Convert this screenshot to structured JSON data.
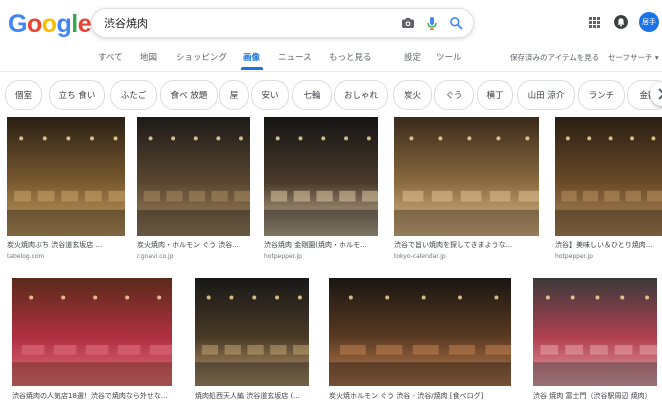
{
  "logo": {
    "text": "Google",
    "letters": [
      "G",
      "o",
      "o",
      "g",
      "l",
      "e"
    ],
    "colors": [
      "#4285f4",
      "#ea4335",
      "#fbbc05",
      "#4285f4",
      "#34a853",
      "#ea4335"
    ]
  },
  "search": {
    "value": "渋谷焼肉",
    "icons": [
      "camera-icon",
      "mic-icon",
      "search-icon"
    ]
  },
  "account": {
    "avatar_text": "居手"
  },
  "tabs": [
    {
      "label": "すべて",
      "active": false
    },
    {
      "label": "地図",
      "active": false
    },
    {
      "label": "ショッピング",
      "active": false
    },
    {
      "label": "画像",
      "active": true
    },
    {
      "label": "ニュース",
      "active": false
    },
    {
      "label": "もっと見る",
      "active": false
    },
    {
      "label": "設定",
      "active": false
    },
    {
      "label": "ツール",
      "active": false
    }
  ],
  "tools_right": {
    "saved": "保存済みのアイテムを見る",
    "safesearch": "セーフサーチ ▾"
  },
  "chips": [
    "個室",
    "立ち 食い",
    "ふたご",
    "食べ 放題",
    "屋",
    "安い",
    "七輪",
    "おしゃれ",
    "炭火",
    "ぐう",
    "横丁",
    "山田 涼介",
    "ランチ",
    "金額"
  ],
  "accent": "#1a73e8",
  "results": [
    {
      "caption": "炭火焼肉ぶち 渋谷道玄坂店 ...",
      "source": "tabelog.com",
      "palette": [
        "#2a2014",
        "#7a5a30",
        "#c8a266"
      ]
    },
    {
      "caption": "炭火焼肉・ホルモン ぐう 渋谷...",
      "source": "r.gnavi.co.jp",
      "palette": [
        "#1c1a18",
        "#5a4630",
        "#a88a60"
      ]
    },
    {
      "caption": "渋谷焼肉 金剛園(焼肉・ホルモ...",
      "source": "hotpepper.jp",
      "palette": [
        "#141414",
        "#4a3a2a",
        "#d8c4a4"
      ]
    },
    {
      "caption": "渋谷で旨い焼肉を探してきまような...",
      "source": "tokyo-calendar.jp",
      "palette": [
        "#3a2a1a",
        "#8a6a40",
        "#e0c090"
      ]
    },
    {
      "caption": "渋谷】美味しい＆ひとり焼肉...",
      "source": "hotpepper.jp",
      "palette": [
        "#2a1e12",
        "#6a4a28",
        "#b89060"
      ]
    },
    {
      "caption": "渋谷焼肉の人気店18選！渋谷で焼肉なら外せな...",
      "source": "",
      "palette": [
        "#5a2a1a",
        "#b03040",
        "#e07080"
      ]
    },
    {
      "caption": "焼肉処西天人編 渋谷道玄坂店 (...",
      "source": "",
      "palette": [
        "#181818",
        "#4a3a26",
        "#c0a070"
      ]
    },
    {
      "caption": "炭火焼ホルモン ぐう 渋谷 - 渋谷/焼肉 [食べログ]",
      "source": "",
      "palette": [
        "#1a1612",
        "#5a3a22",
        "#c08050"
      ]
    },
    {
      "caption": "渋谷 焼肉 富士門（渋谷駅周辺 焼肉）",
      "source": "",
      "palette": [
        "#3a3a3a",
        "#b04050",
        "#e8a0a8"
      ]
    }
  ]
}
